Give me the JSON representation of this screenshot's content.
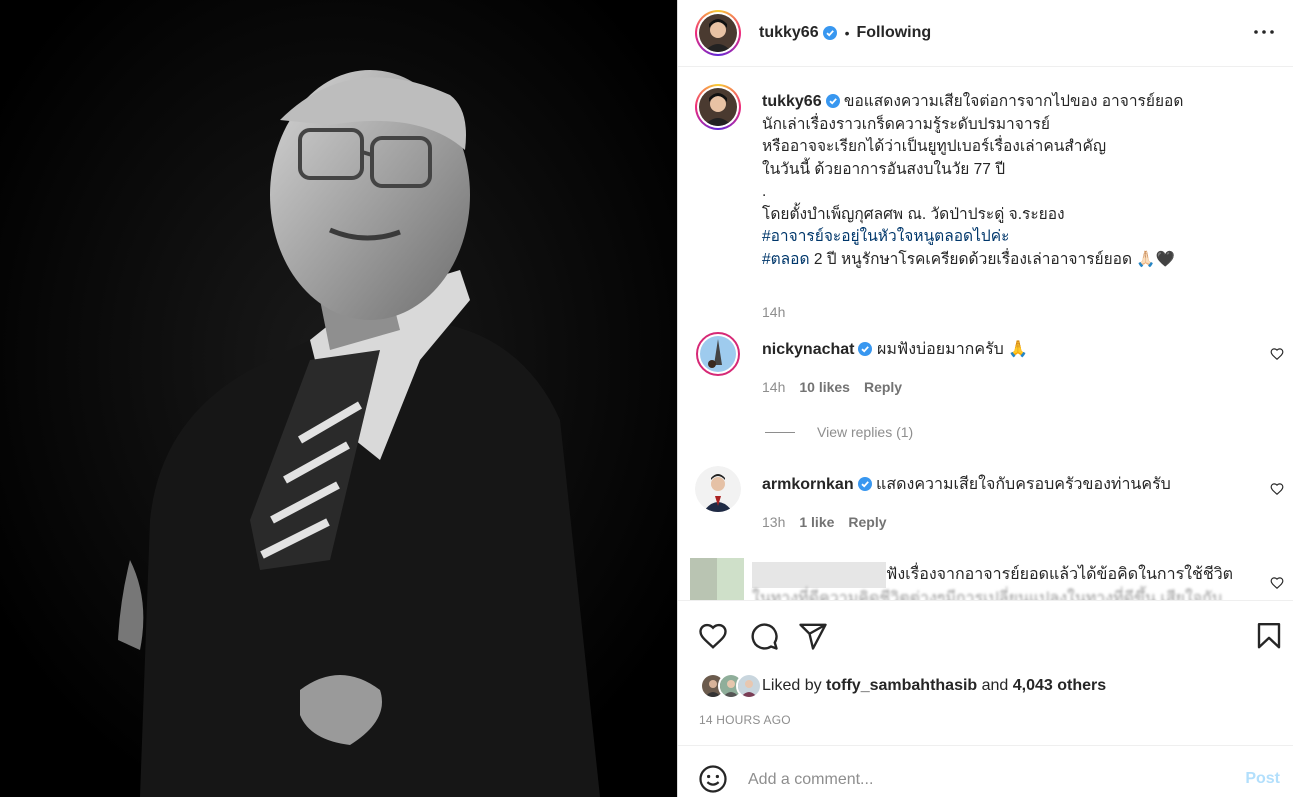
{
  "post": {
    "username": "tukky66",
    "dot": "•",
    "follow_status": "Following",
    "more_icon": "more-options-icon"
  },
  "caption": {
    "username": "tukky66",
    "lines": [
      "ขอแสดงความเสียใจต่อการจากไปของ อาจารย์ยอด",
      "นักเล่าเรื่องราวเกร็ดความรู้ระดับปรมาจารย์",
      "หรืออาจจะเรียกได้ว่าเป็นยูทูปเบอร์เรื่องเล่าคนสำคัญ",
      "ในวันนี้ ด้วยอาการอันสงบในวัย 77 ปี",
      ".",
      "โดยตั้งบำเพ็ญกุศลศพ ณ. วัดป่าประดู่ จ.ระยอง"
    ],
    "hashtag1": "#อาจารย์จะอยู่ในหัวใจหนูตลอดไปค่ะ",
    "hashtag2": "#ตลอด",
    "last_line_rest": " 2 ปี หนูรักษาโรคเครียดด้วยเรื่องเล่าอาจารย์ยอด 🙏🏻🖤",
    "time": "14h"
  },
  "comments": [
    {
      "username": "nickynachat",
      "text": "ผมฟังบ่อยมากครับ 🙏",
      "time": "14h",
      "likes": "10 likes",
      "reply": "Reply",
      "view_replies": "View replies (1)"
    },
    {
      "username": "armkornkan",
      "text": "แสดงความเสียใจกับครอบครัวของท่านครับ",
      "time": "13h",
      "likes": "1 like",
      "reply": "Reply"
    },
    {
      "text": "ฟังเรื่องจากอาจารย์ยอดแล้วได้ข้อคิดในการใช้ชีวิต",
      "text2": "ในทางที่ดีความคิดชีวิตต่างๆมีการเปลี่ยนแปลงในทางที่ดีขึ้น เสียใจกับ"
    }
  ],
  "actions": {
    "liked_by_prefix": "Liked by ",
    "liked_by_user": "toffy_sambahthasib",
    "and": " and ",
    "others": "4,043 others",
    "posted_ago": "14 HOURS AGO"
  },
  "add_comment": {
    "placeholder": "Add a comment...",
    "post_label": "Post"
  },
  "colors": {
    "link_blue": "#00376b",
    "verified_blue": "#3897f0",
    "post_disabled": "#b2dffc",
    "muted_text": "#8e8e8e"
  }
}
